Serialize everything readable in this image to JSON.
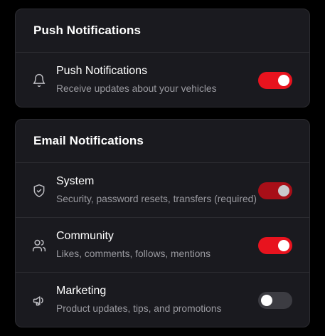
{
  "push_section": {
    "title": "Push Notifications",
    "items": [
      {
        "title": "Push Notifications",
        "description": "Receive updates about your vehicles",
        "icon": "bell-icon",
        "enabled": true,
        "locked": false
      }
    ]
  },
  "email_section": {
    "title": "Email Notifications",
    "items": [
      {
        "title": "System",
        "description": "Security, password resets, transfers (required)",
        "icon": "shield-check-icon",
        "enabled": true,
        "locked": true
      },
      {
        "title": "Community",
        "description": "Likes, comments, follows, mentions",
        "icon": "users-icon",
        "enabled": true,
        "locked": false
      },
      {
        "title": "Marketing",
        "description": "Product updates, tips, and promotions",
        "icon": "megaphone-icon",
        "enabled": false,
        "locked": false
      }
    ]
  },
  "colors": {
    "accent": "#e8131e",
    "accent_disabled": "#a80f18",
    "toggle_off": "#3c3c42",
    "card_background": "#1a1a1f",
    "page_background": "#000000"
  }
}
